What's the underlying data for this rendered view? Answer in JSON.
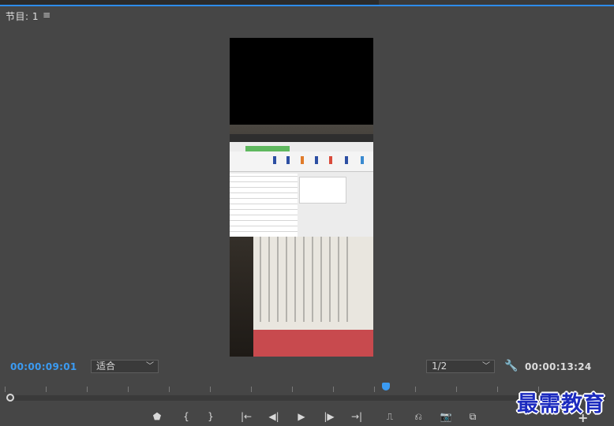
{
  "panel": {
    "tab_title": "节目: 1",
    "tab_menu_glyph": "≡"
  },
  "controls": {
    "current_timecode": "00:00:09:01",
    "fit_select": {
      "value": "适合"
    },
    "resolution_select": {
      "value": "1/2"
    },
    "duration_timecode": "00:00:13:24"
  },
  "transport": {
    "marker": "⬟",
    "mark_in": "{",
    "mark_out": "}",
    "go_to_in": "|←",
    "step_back": "◀|",
    "play": "▶",
    "step_forward": "|▶",
    "go_to_out": "→|",
    "lift": "⎍",
    "extract": "⎌",
    "export_frame": "📷",
    "compare": "⧉",
    "add": "+"
  },
  "watermark": "最需教育",
  "colors": {
    "accent": "#3b9bf2",
    "panel_bg": "#464646",
    "watermark": "#1c2bbf"
  }
}
